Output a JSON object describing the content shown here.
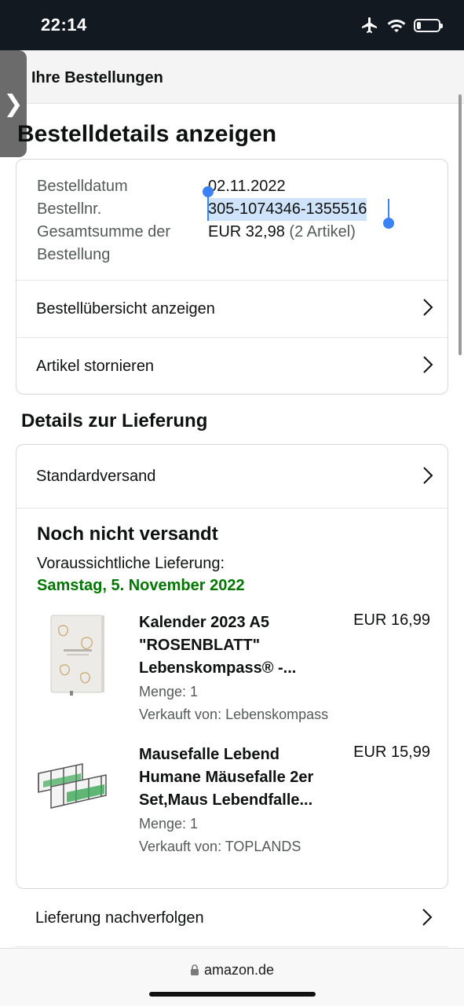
{
  "status_bar": {
    "time": "22:14",
    "icons": [
      "airplane-icon",
      "wifi-icon",
      "battery-icon"
    ],
    "battery_level": 0.2
  },
  "nav": {
    "back_label": "Ihre Bestellungen"
  },
  "page": {
    "title": "Bestelldetails anzeigen"
  },
  "order_info": {
    "date_label": "Bestelldatum",
    "date_value": "02.11.2022",
    "number_label": "Bestellnr.",
    "number_value": "305-1074346-1355516",
    "total_label": "Gesamtsumme der Bestellung",
    "total_value": "EUR 32,98",
    "total_items": "(2 Artikel)"
  },
  "order_actions": [
    {
      "label": "Bestellübersicht anzeigen"
    },
    {
      "label": "Artikel stornieren"
    }
  ],
  "delivery": {
    "section_title": "Details zur Lieferung",
    "shipping_method": "Standardversand",
    "status": "Noch nicht versandt",
    "eta_label": "Voraussichtliche Lieferung:",
    "eta_date": "Samstag, 5. November 2022",
    "items": [
      {
        "name": "Kalender 2023 A5 \"ROSENBLATT\" Lebenskompass® -...",
        "price": "EUR 16,99",
        "quantity": "Menge: 1",
        "seller": "Verkauft von: Lebenskompass"
      },
      {
        "name": "Mausefalle Lebend Humane Mäusefalle 2er Set,Maus Lebendfalle...",
        "price": "EUR 15,99",
        "quantity": "Menge: 1",
        "seller": "Verkauft von: TOPLANDS"
      }
    ]
  },
  "track": {
    "label": "Lieferung nachverfolgen"
  },
  "browser": {
    "url": "amazon.de"
  },
  "colors": {
    "header_bg": "#131921",
    "delivery_green": "#007600",
    "selection": "#cfe3fb",
    "handle": "#3b82f6"
  }
}
